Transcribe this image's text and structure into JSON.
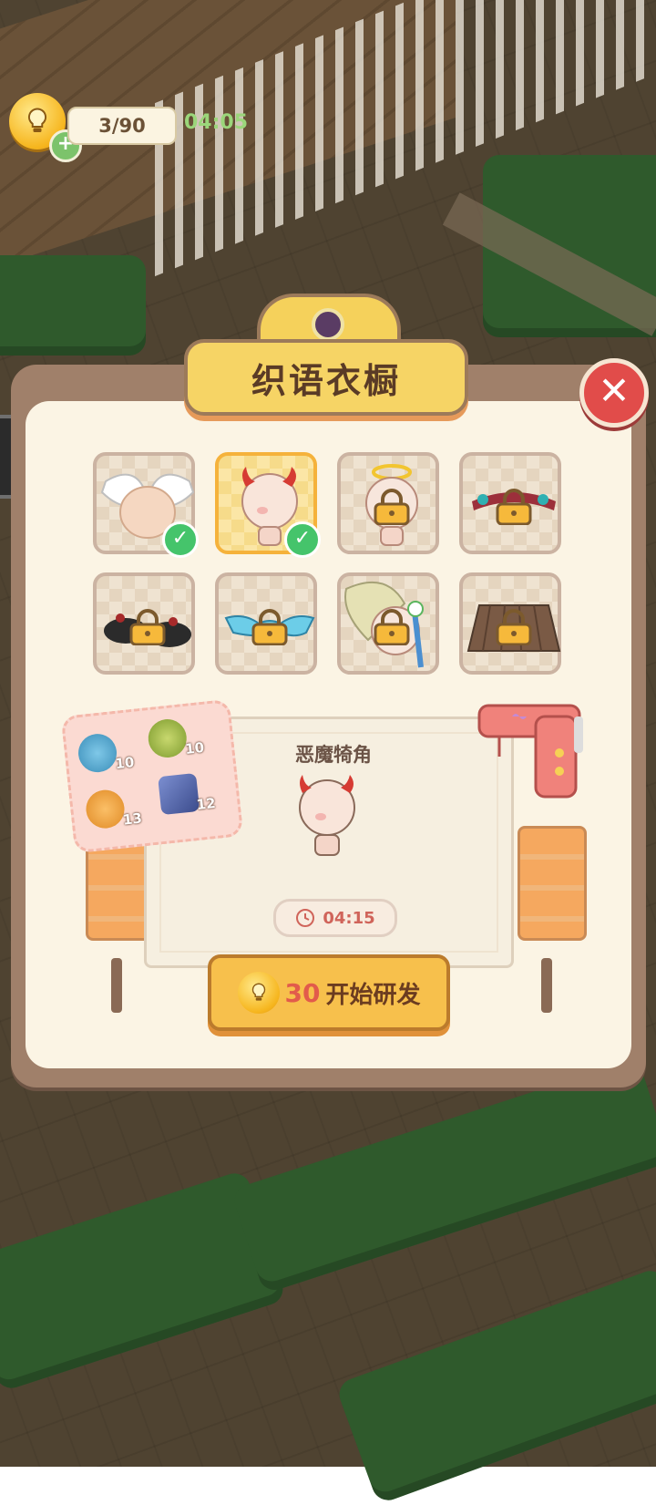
{
  "hud": {
    "energy": "3/90",
    "timer": "04:05",
    "icons": {
      "energy": "lightbulb-icon",
      "add": "plus-icon"
    }
  },
  "dialog": {
    "title": "织语衣橱",
    "close_icon": "close-icon",
    "side_tab_icon": "chevron-right-icon"
  },
  "wardrobe": {
    "items": [
      {
        "name": "angel-wings",
        "unlocked": true,
        "owned": true
      },
      {
        "name": "devil-horns",
        "unlocked": true,
        "owned": true,
        "selected": true
      },
      {
        "name": "halo",
        "locked": true
      },
      {
        "name": "jeweled-headband",
        "locked": true
      },
      {
        "name": "black-shoes",
        "locked": true
      },
      {
        "name": "blue-goggles",
        "locked": true
      },
      {
        "name": "flower-hat",
        "locked": true
      },
      {
        "name": "plaid-skirt",
        "locked": true
      }
    ]
  },
  "workbench": {
    "item_name": "恶魔犄角",
    "time": "04:15",
    "materials": [
      {
        "icon": "yarn-ball-icon",
        "count": "10"
      },
      {
        "icon": "scissors-icon",
        "count": "10"
      },
      {
        "icon": "button-icon",
        "count": "13"
      },
      {
        "icon": "fabric-icon",
        "count": "12"
      }
    ]
  },
  "research_button": {
    "cost": "30",
    "label": "开始研发"
  },
  "colors": {
    "accent": "#f6d465",
    "close": "#e14c4a",
    "check": "#45c46b",
    "timer": "#9bd67a"
  }
}
